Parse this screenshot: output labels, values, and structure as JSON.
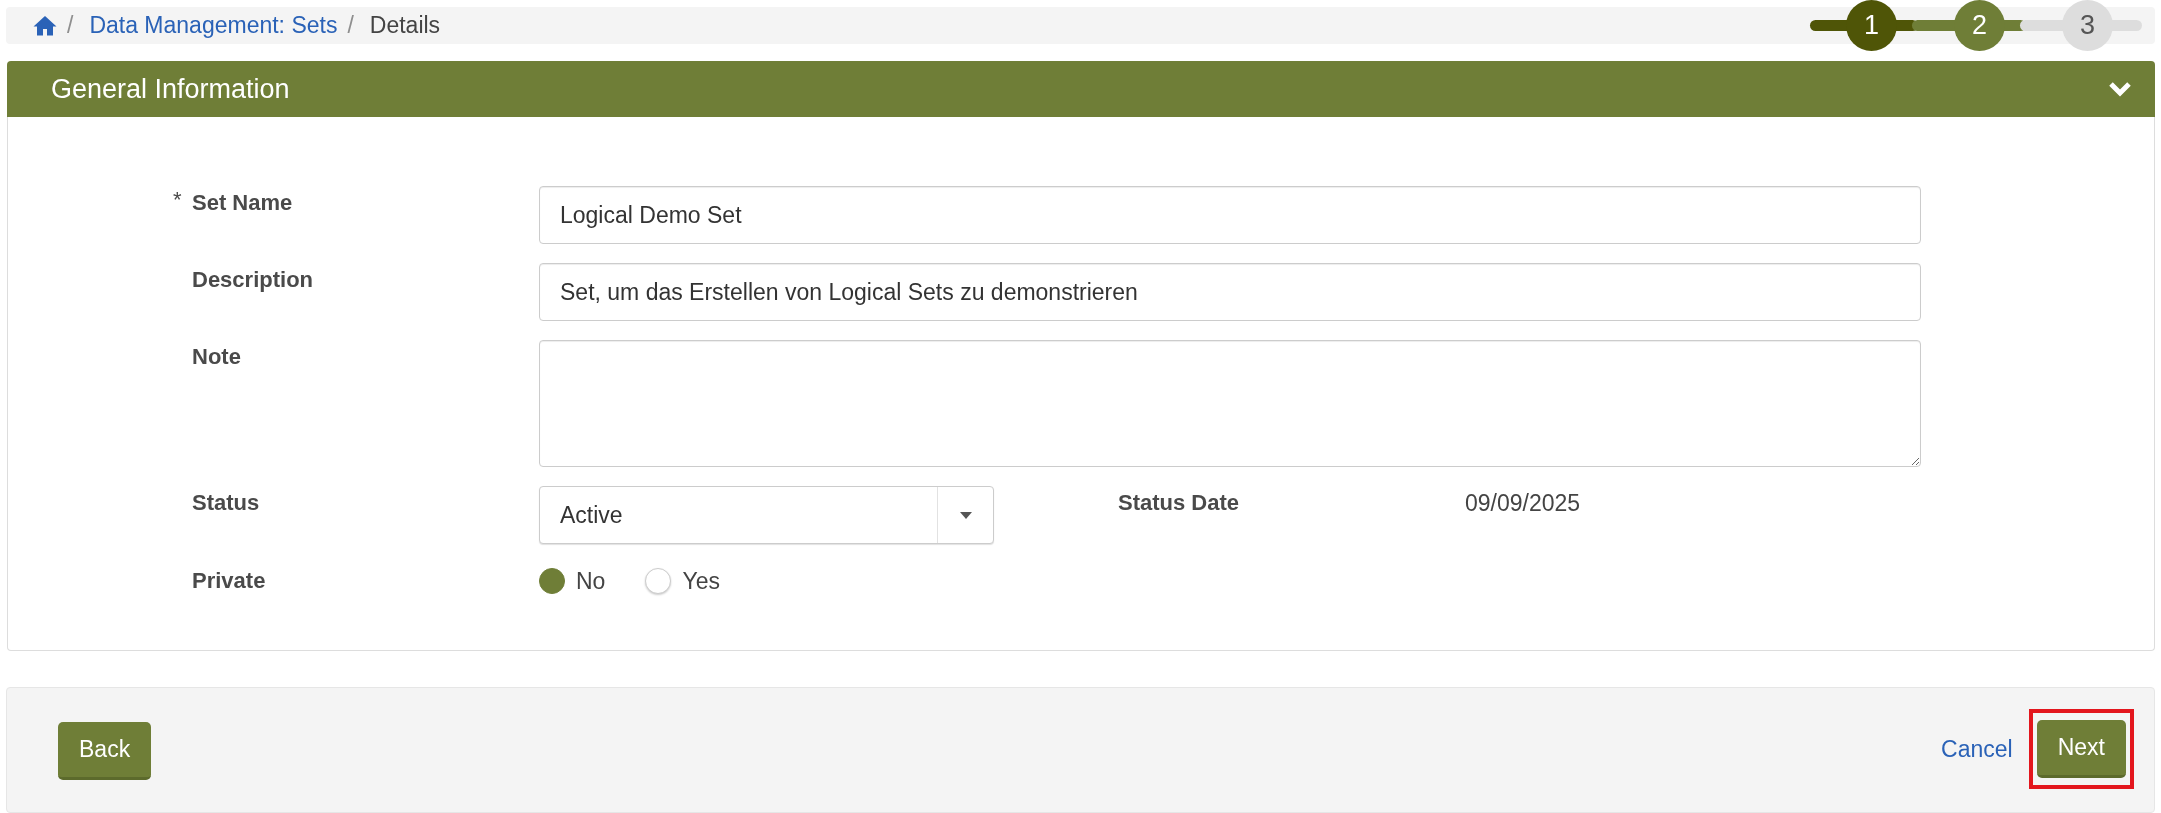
{
  "breadcrumb": {
    "items": [
      {
        "kind": "home",
        "separator": "/"
      },
      {
        "kind": "link",
        "label": "Data Management: Sets",
        "separator": "/"
      },
      {
        "kind": "current",
        "label": "Details"
      }
    ]
  },
  "stepper": {
    "steps": [
      {
        "label": "1",
        "selected": true,
        "disabled": false
      },
      {
        "label": "2",
        "selected": false,
        "disabled": false
      },
      {
        "label": "3",
        "selected": false,
        "disabled": true
      }
    ]
  },
  "panel": {
    "title": "General Information",
    "expanded": true,
    "rows": [
      {
        "fields": [
          {
            "kind": "text",
            "required_mark": "*",
            "label": "Set Name",
            "value": "Logical Demo Set"
          }
        ]
      },
      {
        "fields": [
          {
            "kind": "text",
            "label": "Description",
            "value": "Set, um das Erstellen von Logical Sets zu demonstrieren"
          }
        ]
      },
      {
        "fields": [
          {
            "kind": "textarea",
            "label": "Note"
          }
        ]
      },
      {
        "fields": [
          {
            "kind": "select",
            "label": "Status",
            "value": "Active"
          },
          {
            "kind": "value",
            "label": "Status Date",
            "value": "09/09/2025"
          }
        ]
      },
      {
        "fields": [
          {
            "kind": "radio",
            "label": "Private",
            "options": [
              {
                "label": "No",
                "selected": true
              },
              {
                "label": "Yes",
                "selected": false
              }
            ]
          }
        ]
      }
    ]
  },
  "footer": {
    "left": [
      {
        "kind": "button",
        "label": "Back",
        "highlighted": false
      }
    ],
    "right": [
      {
        "kind": "link",
        "label": "Cancel",
        "highlighted": false
      },
      {
        "kind": "button",
        "label": "Next",
        "highlighted": true
      }
    ]
  }
}
